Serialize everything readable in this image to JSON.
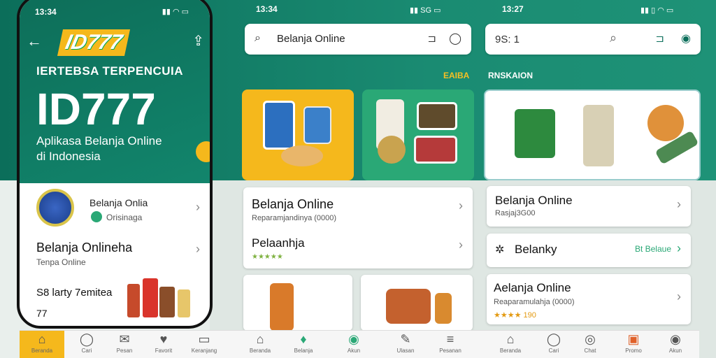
{
  "screens": {
    "left": {
      "time": "13:34",
      "brand_logo": "ID777",
      "tagline": "IERTEBSA TERPENCUIA",
      "big_title": "ID777",
      "subtitle_line1": "Aplikasa Belanja Online",
      "subtitle_line2": "di Indonesia",
      "items": [
        {
          "title": "Belanja Onlia",
          "sub": "Orisinaga"
        },
        {
          "title": "Belanja Onlineha",
          "sub": "Tenpa Online"
        },
        {
          "title": "S8 larty 7emitea",
          "sub": "77"
        }
      ]
    },
    "middle": {
      "time": "13:34",
      "status_text": "SG",
      "search_value": "Belanja Online",
      "section_label": "EAIBA",
      "card1": {
        "title": "Belanja Online",
        "sub": "Reparamjandinya (0000)"
      },
      "card2": {
        "title": "Pelaanhja",
        "stars": "★★★★★"
      }
    },
    "right": {
      "time": "13:27",
      "search_value": "9S: 1",
      "section_label": "RNSKAION",
      "card1": {
        "title": "Belanja Online",
        "sub": "Rasjaj3G00"
      },
      "card2": {
        "title": "Belanky",
        "link": "Bt Belaue"
      },
      "card3": {
        "title": "Aelanja Online",
        "sub": "Reaparamulahja (0000)",
        "rating": "★★★★ 190"
      }
    }
  },
  "tabs": [
    {
      "icon": "home-icon",
      "glyph": "⌂",
      "label": "Beranda"
    },
    {
      "icon": "search-icon",
      "glyph": "◯",
      "label": "Cari"
    },
    {
      "icon": "mail-icon",
      "glyph": "✉",
      "label": "Pesan"
    },
    {
      "icon": "heart-icon",
      "glyph": "♥",
      "label": "Favorit"
    },
    {
      "icon": "cart-icon",
      "glyph": "▭",
      "label": "Keranjang"
    },
    {
      "icon": "home-icon",
      "glyph": "⌂",
      "label": "Beranda"
    },
    {
      "icon": "bag-icon",
      "glyph": "♦",
      "label": "Belanja"
    },
    {
      "icon": "user-icon",
      "glyph": "◉",
      "label": "Akun"
    },
    {
      "icon": "edit-icon",
      "glyph": "✎",
      "label": "Ulasan"
    },
    {
      "icon": "list-icon",
      "glyph": "≡",
      "label": "Pesanan"
    },
    {
      "icon": "home-icon",
      "glyph": "⌂",
      "label": "Beranda"
    },
    {
      "icon": "search-icon",
      "glyph": "◯",
      "label": "Cari"
    },
    {
      "icon": "chat-icon",
      "glyph": "◎",
      "label": "Chat"
    },
    {
      "icon": "gift-icon",
      "glyph": "▣",
      "label": "Promo"
    },
    {
      "icon": "user-icon",
      "glyph": "◉",
      "label": "Akun"
    }
  ],
  "colors": {
    "teal": "#0b6e5a",
    "yellow": "#f5b81c",
    "green": "#2aa876"
  }
}
